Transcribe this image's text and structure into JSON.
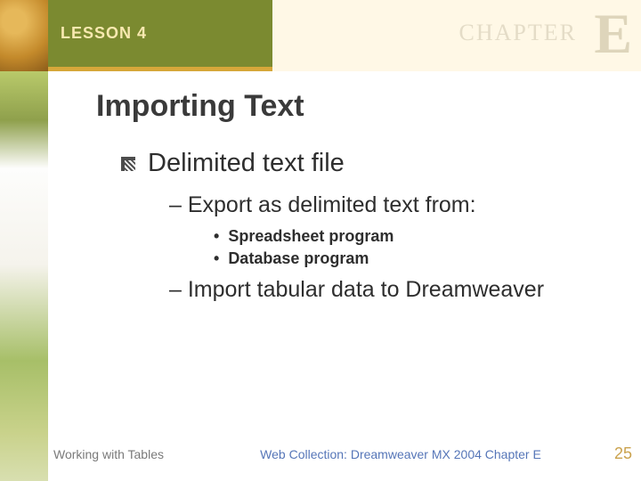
{
  "header": {
    "lesson_label": "LESSON 4",
    "chapter_label": "CHAPTER",
    "chapter_letter": "E"
  },
  "title": "Importing Text",
  "body": {
    "lvl1": "Delimited text file",
    "lvl2a": "– Export as delimited text from:",
    "lvl3a": "Spreadsheet program",
    "lvl3b": "Database program",
    "lvl2b": "– Import tabular data to Dreamweaver"
  },
  "footer": {
    "left": "Working with Tables",
    "center": "Web Collection: Dreamweaver MX 2004 Chapter E",
    "page": "25"
  }
}
